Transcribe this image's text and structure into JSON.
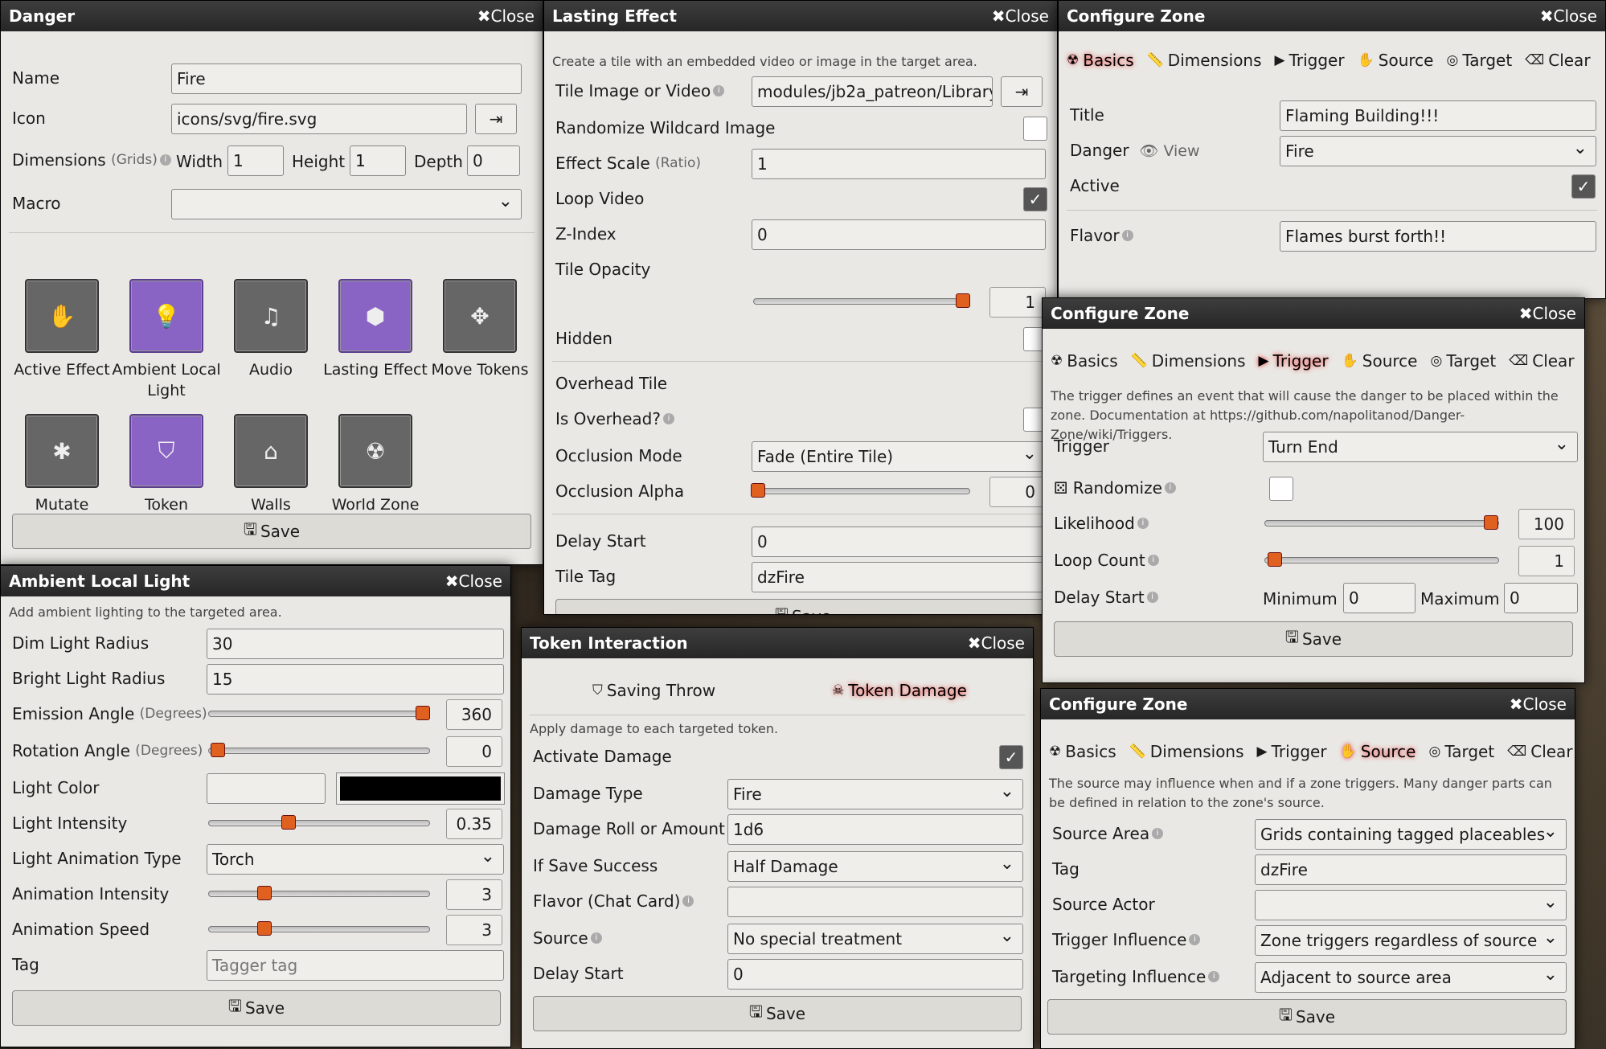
{
  "common": {
    "close": "✖Close",
    "save": "Save"
  },
  "danger": {
    "title": "Danger",
    "name_label": "Name",
    "name_value": "Fire",
    "icon_label": "Icon",
    "icon_value": "icons/svg/fire.svg",
    "dim_label": "Dimensions",
    "dim_hint": "(Grids)",
    "width_label": "Width",
    "width_value": "1",
    "height_label": "Height",
    "height_value": "1",
    "depth_label": "Depth",
    "depth_value": "0",
    "macro_label": "Macro",
    "macro_value": "",
    "tiles": [
      {
        "label": "Active Effect",
        "icon": "hand-icon",
        "glyph": "✋",
        "on": false
      },
      {
        "label": "Ambient Local Light",
        "icon": "lightbulb-icon",
        "glyph": "💡",
        "on": true
      },
      {
        "label": "Audio",
        "icon": "music-icon",
        "glyph": "♫",
        "on": false
      },
      {
        "label": "Lasting Effect",
        "icon": "cube-icon",
        "glyph": "⬢",
        "on": true
      },
      {
        "label": "Move Tokens",
        "icon": "arrows-icon",
        "glyph": "✥",
        "on": false
      },
      {
        "label": "Mutate",
        "icon": "spider-icon",
        "glyph": "✱",
        "on": false
      },
      {
        "label": "Token Interaction",
        "icon": "shield-icon",
        "glyph": "⛉",
        "on": true
      },
      {
        "label": "Walls",
        "icon": "landmark-icon",
        "glyph": "⌂",
        "on": false
      },
      {
        "label": "World Zone",
        "icon": "radiation-icon",
        "glyph": "☢",
        "on": false
      }
    ],
    "bg_tab": "House"
  },
  "light": {
    "title": "Ambient Local Light",
    "desc": "Add ambient lighting to the targeted area.",
    "dim_label": "Dim Light Radius",
    "dim_value": "30",
    "bright_label": "Bright Light Radius",
    "bright_value": "15",
    "emission_label": "Emission Angle",
    "emission_hint": "(Degrees)",
    "emission_value": "360",
    "emission_frac": 0.97,
    "rotation_label": "Rotation Angle",
    "rotation_hint": "(Degrees)",
    "rotation_value": "0",
    "rotation_frac": 0.04,
    "color_label": "Light Color",
    "intensity_label": "Light Intensity",
    "intensity_value": "0.35",
    "intensity_frac": 0.36,
    "anim_type_label": "Light Animation Type",
    "anim_type_value": "Torch",
    "anim_int_label": "Animation Intensity",
    "anim_int_value": "3",
    "anim_int_frac": 0.25,
    "anim_speed_label": "Animation Speed",
    "anim_speed_value": "3",
    "anim_speed_frac": 0.25,
    "tag_label": "Tag",
    "tag_placeholder": "Tagger tag"
  },
  "lasting": {
    "title": "Lasting Effect",
    "desc": "Create a tile with an embedded video or image in the target area.",
    "tile_label": "Tile Image or Video",
    "tile_value": "modules/jb2a_patreon/Library/(",
    "rand_label": "Randomize Wildcard Image",
    "scale_label": "Effect Scale",
    "scale_hint": "(Ratio)",
    "scale_value": "1",
    "loop_label": "Loop Video",
    "z_label": "Z-Index",
    "z_value": "0",
    "opacity_label": "Tile Opacity",
    "opacity_value": "1",
    "opacity_frac": 0.97,
    "hidden_label": "Hidden",
    "overhead_label": "Overhead Tile",
    "is_overhead_label": "Is Overhead?",
    "occ_mode_label": "Occlusion Mode",
    "occ_mode_value": "Fade (Entire Tile)",
    "occ_alpha_label": "Occlusion Alpha",
    "occ_alpha_value": "0",
    "occ_alpha_frac": 0.02,
    "delay_label": "Delay Start",
    "delay_value": "0",
    "tag_label": "Tile Tag",
    "tag_value": "dzFire",
    "bg_text": "Flaming"
  },
  "token": {
    "title": "Token Interaction",
    "tab1": "Saving Throw",
    "tab2": "Token Damage",
    "desc": "Apply damage to each targeted token.",
    "activate_label": "Activate Damage",
    "type_label": "Damage Type",
    "type_value": "Fire",
    "roll_label": "Damage Roll or Amount",
    "roll_value": "1d6",
    "success_label": "If Save Success",
    "success_value": "Half Damage",
    "flavor_label": "Flavor (Chat Card)",
    "flavor_value": "",
    "source_label": "Source",
    "source_value": "No special treatment",
    "delay_label": "Delay Start",
    "delay_value": "0"
  },
  "zone_tabs": [
    "Basics",
    "Dimensions",
    "Trigger",
    "Source",
    "Target",
    "Clear"
  ],
  "zone1": {
    "title": "Configure Zone",
    "title_label": "Title",
    "title_value": "Flaming Building!!!",
    "danger_label": "Danger",
    "view_label": "View",
    "danger_value": "Fire",
    "active_label": "Active",
    "flavor_label": "Flavor",
    "flavor_value": "Flames burst forth!!"
  },
  "zone2": {
    "title": "Configure Zone",
    "desc": "The trigger defines an event that will cause the danger to be placed within the zone. Documentation at https://github.com/napolitanod/Danger-Zone/wiki/Triggers.",
    "trigger_label": "Trigger",
    "trigger_value": "Turn End",
    "rand_label": "Randomize",
    "likelihood_label": "Likelihood",
    "likelihood_value": "100",
    "likelihood_frac": 0.97,
    "loop_label": "Loop Count",
    "loop_value": "1",
    "loop_frac": 0.04,
    "delay_label": "Delay Start",
    "min_label": "Minimum",
    "min_value": "0",
    "max_label": "Maximum",
    "max_value": "0",
    "bg_tab": "House"
  },
  "zone3": {
    "title": "Configure Zone",
    "desc": "The source may influence when and if a zone triggers. Many danger parts can be defined in relation to the zone's source.",
    "area_label": "Source Area",
    "area_value": "Grids containing tagged placeables",
    "tag_label": "Tag",
    "tag_value": "dzFire",
    "actor_label": "Source Actor",
    "actor_value": "",
    "trig_label": "Trigger Influence",
    "trig_value": "Zone triggers regardless of source",
    "targ_label": "Targeting Influence",
    "targ_value": "Adjacent to source area",
    "bg_tab": "House"
  }
}
